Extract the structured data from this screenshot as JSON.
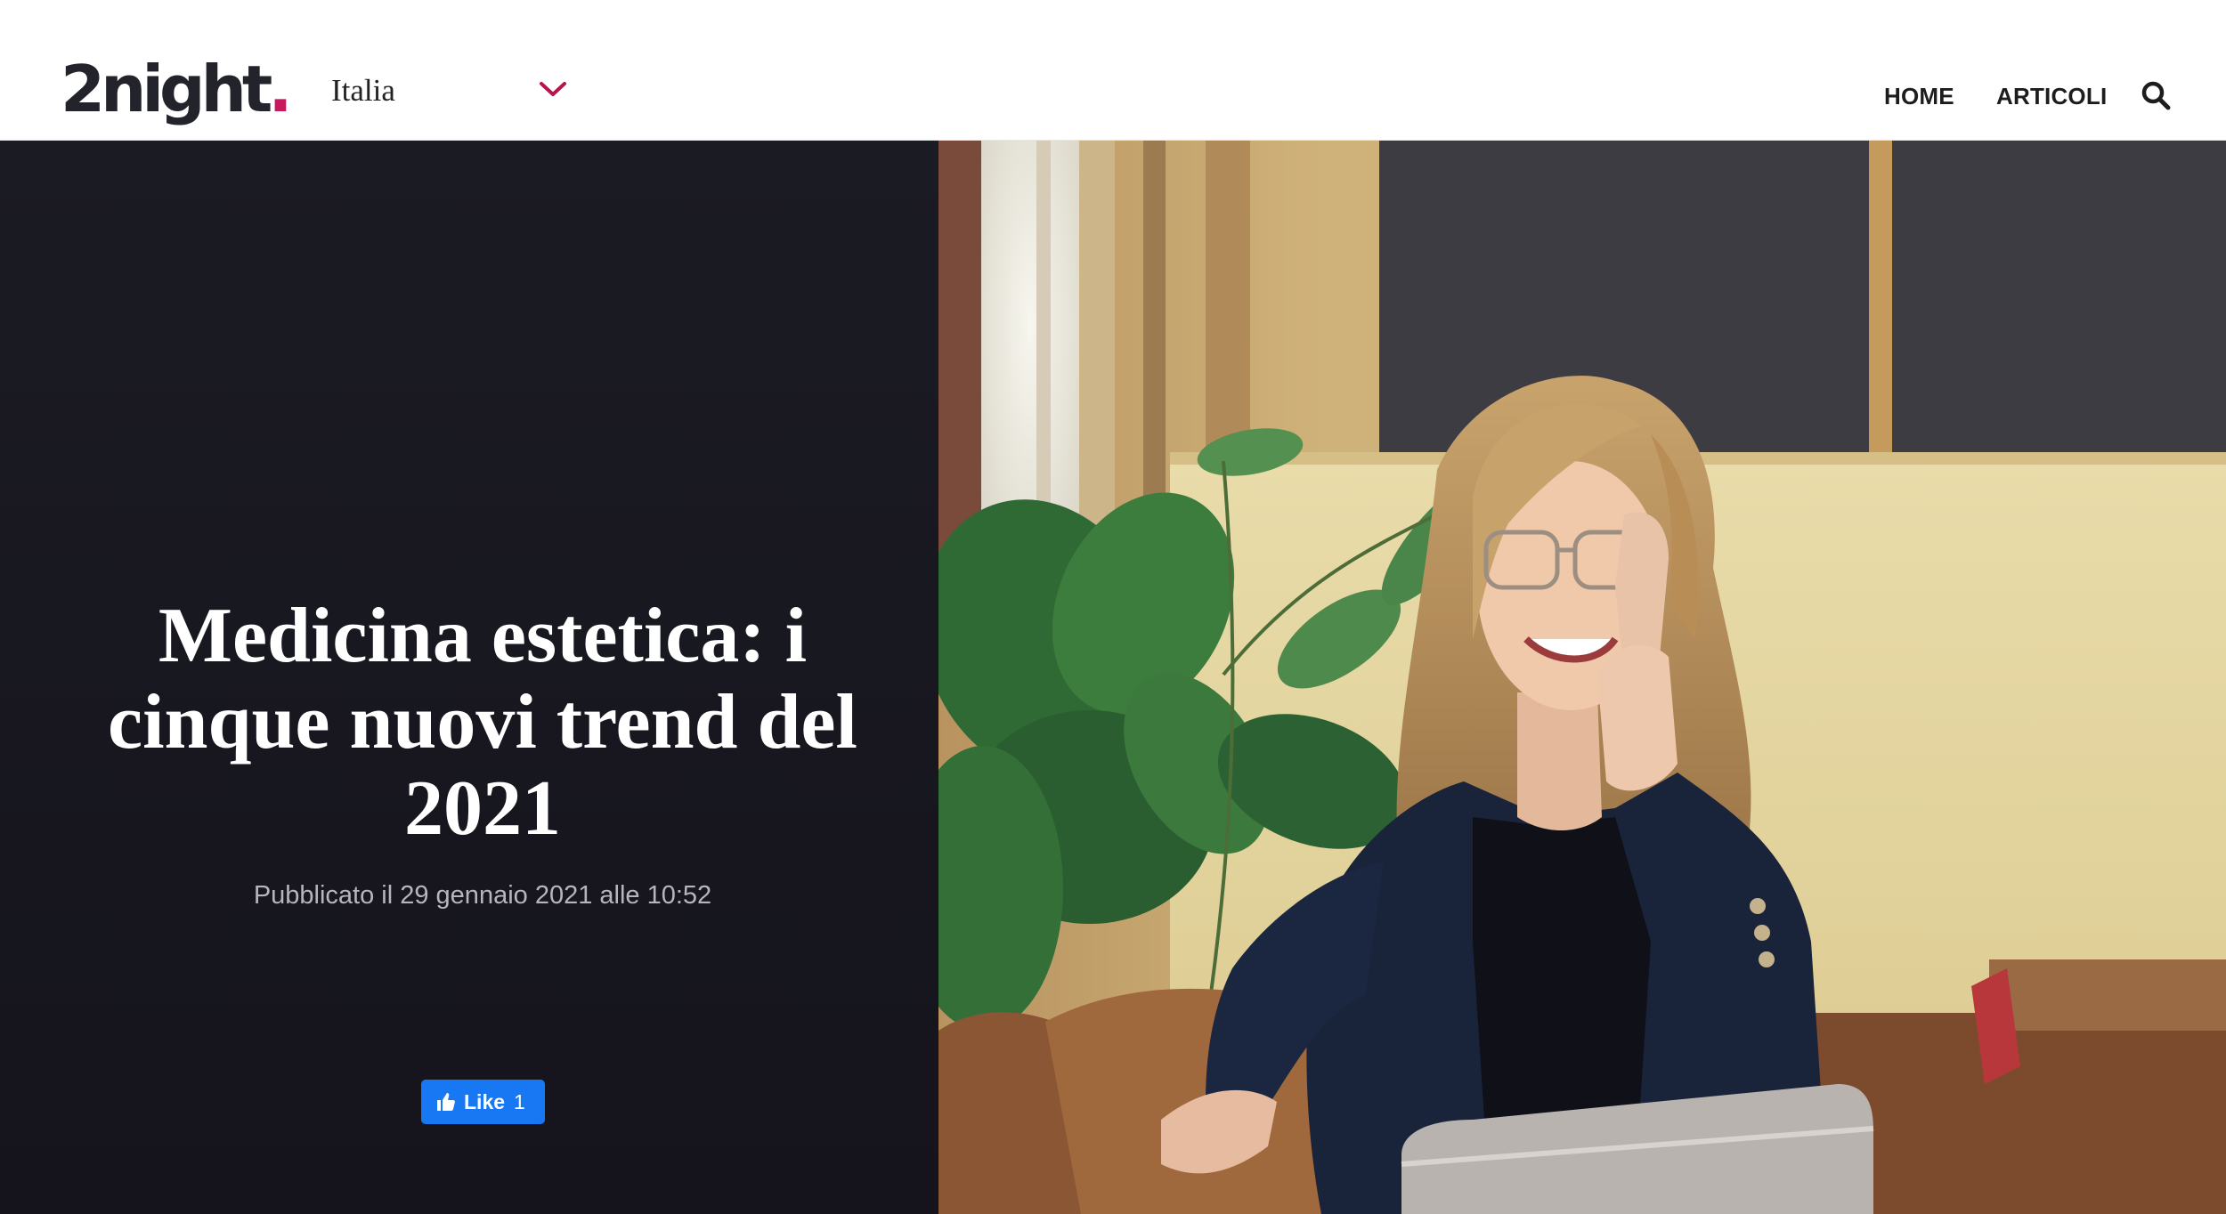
{
  "header": {
    "logo_text": "2night",
    "logo_dot": ".",
    "region": "Italia",
    "nav": {
      "home": "HOME",
      "articoli": "ARTICOLI"
    }
  },
  "hero": {
    "title": "Medicina estetica: i cinque nuovi trend del 2021",
    "published": "Pubblicato il 29 gennaio 2021 alle 10:52",
    "like": {
      "label": "Like",
      "count": "1"
    }
  },
  "colors": {
    "brand_dot": "#c8195f",
    "chevron": "#b6134f",
    "hero_background": "#17161e",
    "facebook_blue": "#1877f2"
  },
  "icons": [
    "chevron-down-icon",
    "search-icon",
    "thumbs-up-icon"
  ]
}
